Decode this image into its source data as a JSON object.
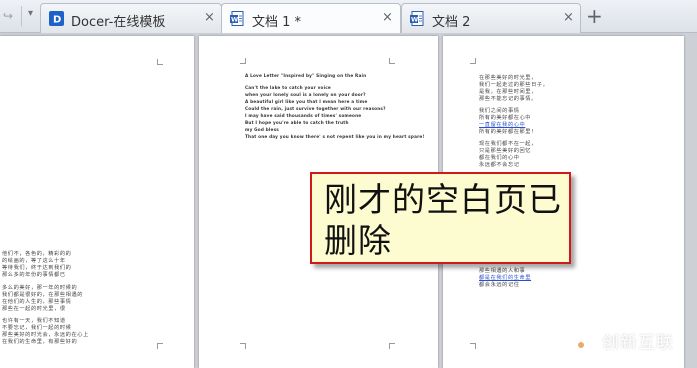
{
  "tabs": [
    {
      "label": "Docer-在线模板",
      "icon": "docer-icon",
      "close": "×"
    },
    {
      "label": "文档 1 *",
      "icon": "word-doc-icon",
      "close": "×"
    },
    {
      "label": "文档 2",
      "icon": "word-doc-icon",
      "close": "×"
    }
  ],
  "tabbar": {
    "new_tab": "+",
    "forward": "↪",
    "menu": "▾"
  },
  "colors": {
    "callout_border": "#d01a1a",
    "callout_bg": "#fdfbd0",
    "link": "#2b4fd0"
  },
  "page_left": {
    "lines": [
      "他们不，各色的，精彩的的",
      "的绘画的，等了这么十年",
      "等待我们，终于达到我们的",
      "那么多的年份的事情都已",
      "多么的美好，那一年的时候的",
      "我们都是很好的，在那些相遇的",
      "在他们的人生的，那些事情",
      "那些在一起的时光里，很",
      "也许有一天，我们不知道",
      "不要忘记，我们一起的时候",
      "那些美好的时光会，永远的在心上",
      "在我们的生命里，有那些好的"
    ]
  },
  "page_middle": {
    "lines": [
      "A Love Letter \"Inspired by\" Singing on the Rain",
      "Can't the lake to catch your voice",
      "when your lonely soul is a lonely on your door?",
      "A beautiful girl like you that I mean here a time",
      "Could the rain, just survive together with our reasons?",
      "I may have said thousands of times' someone",
      "But I hope you're able to catch the truth",
      "my God bless",
      "That one day you know there' s not repent like you in my heart spare!"
    ]
  },
  "page_right": {
    "blocks": [
      [
        "在那些美好的时光里，",
        "我们一起走过的那些日子，",
        "是我，在那些时间里，",
        "那些不能忘记的事情。"
      ],
      [
        "我们之间的事情",
        "所有的美好都在心中",
        "一直留在我的心中",
        "所有的美好都在那里！"
      ],
      [
        "现在我们都不在一起，",
        "只是那些美好的回忆",
        "都在我们的心中",
        "永远都不会忘记"
      ],
      [
        "那些相遇的人和事",
        "都是在我们的生命里",
        "都会永远的记住"
      ]
    ]
  },
  "callout": {
    "text": "刚才的空白页已删除"
  },
  "watermark": {
    "text": "创新互联",
    "sub": "CHUANG XIN HU LIAN"
  }
}
